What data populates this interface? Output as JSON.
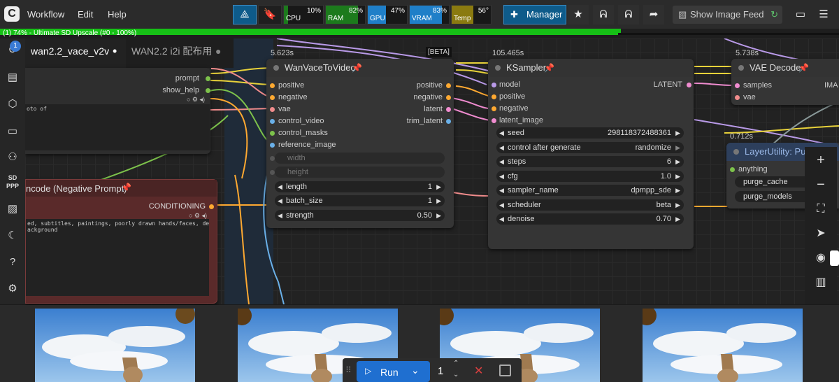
{
  "menu": {
    "logo": "C",
    "items": [
      "Workflow",
      "Edit",
      "Help"
    ]
  },
  "perf": {
    "meters": [
      {
        "label": "CPU",
        "value": "10%",
        "level": 0.1,
        "color": "#1c7a1c"
      },
      {
        "label": "RAM",
        "value": "82%",
        "level": 0.82,
        "color": "#1c7a1c"
      },
      {
        "label": "GPU",
        "value": "47%",
        "level": 0.47,
        "color": "#1f7fc8"
      },
      {
        "label": "VRAM",
        "value": "83%",
        "level": 0.83,
        "color": "#1f7fc8"
      },
      {
        "label": "Temp",
        "value": "56°",
        "level": 0.56,
        "color": "#8a7a10"
      }
    ]
  },
  "toolbar": {
    "manager_label": "Manager",
    "feed_label": "Show Image Feed"
  },
  "progress": {
    "text": "(1) 74% - Ultimate SD Upscale (#0 - 100%)",
    "fraction": 0.74,
    "color": "#16c016"
  },
  "tabs": [
    {
      "label": "wan2.2_vace_v2v",
      "active": true
    },
    {
      "label": "WAN2.2 i2i 配布用",
      "active": false
    }
  ],
  "queue_badge": "1",
  "left_node": {
    "outputs": [
      "prompt",
      "show_help"
    ],
    "text_fragment": "oto of",
    "neg_title": "ncode (Negative Prompt)",
    "neg_output": "CONDITIONING",
    "neg_text": "ed, subtitles, paintings, poorly drawn hands/faces, deformed\nackground"
  },
  "wan_node": {
    "timing": "5.623s",
    "title": "WanVaceToVideo",
    "inputs": [
      "positive",
      "negative",
      "vae",
      "control_video",
      "control_masks",
      "reference_image"
    ],
    "outputs": [
      "positive",
      "negative",
      "latent",
      "trim_latent"
    ],
    "disabled_widgets": [
      "width",
      "height"
    ],
    "widgets": [
      {
        "label": "length",
        "value": "1"
      },
      {
        "label": "batch_size",
        "value": "1"
      },
      {
        "label": "strength",
        "value": "0.50"
      }
    ]
  },
  "ksampler": {
    "badge": "[BETA]",
    "timing": "105.465s",
    "title": "KSampler",
    "inputs": [
      "model",
      "positive",
      "negative",
      "latent_image"
    ],
    "output": "LATENT",
    "widgets": [
      {
        "label": "seed",
        "value": "298118372488361"
      },
      {
        "label": "control after generate",
        "value": "randomize"
      },
      {
        "label": "steps",
        "value": "6"
      },
      {
        "label": "cfg",
        "value": "1.0"
      },
      {
        "label": "sampler_name",
        "value": "dpmpp_sde"
      },
      {
        "label": "scheduler",
        "value": "beta"
      },
      {
        "label": "denoise",
        "value": "0.70"
      }
    ]
  },
  "vae_node": {
    "timing": "5.738s",
    "title": "VAE Decode",
    "inputs": [
      "samples",
      "vae"
    ],
    "output_fragment": "IMA"
  },
  "layer_node": {
    "timing": "0.712s",
    "title": "LayerUtility: Purg",
    "inputs": [
      "anything"
    ],
    "options": [
      "purge_cache",
      "purge_models"
    ]
  },
  "runbar": {
    "run_label": "Run",
    "count": "1"
  }
}
